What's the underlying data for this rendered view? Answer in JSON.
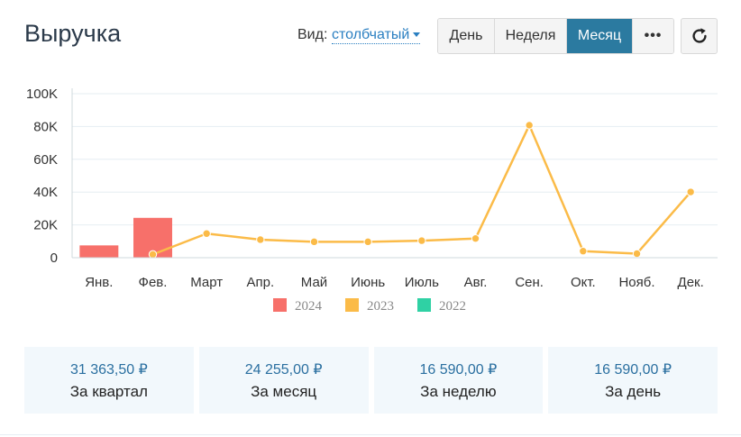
{
  "header": {
    "title": "Выручка",
    "view_label": "Вид:",
    "view_value": "столбчатый",
    "periods": [
      "День",
      "Неделя",
      "Месяц"
    ],
    "active_period": "Месяц",
    "more_label": "•••"
  },
  "icons": {
    "refresh": "refresh-icon",
    "more": "more-icon",
    "caret": "chevron-down-icon"
  },
  "colors": {
    "s2024": "#f7706a",
    "s2023": "#fbbb48",
    "s2022": "#2fd1a4",
    "accent": "#2b7aa0"
  },
  "chart_data": {
    "type": "bar",
    "categories": [
      "Янв.",
      "Фев.",
      "Март",
      "Апр.",
      "Май",
      "Июнь",
      "Июль",
      "Авг.",
      "Сен.",
      "Окт.",
      "Нояб.",
      "Дек."
    ],
    "ylim": [
      0,
      100000
    ],
    "yticks": [
      0,
      20000,
      40000,
      60000,
      80000,
      100000
    ],
    "ytick_labels": [
      "0",
      "20K",
      "40K",
      "60K",
      "80K",
      "100K"
    ],
    "grid": true,
    "legend": "bottom",
    "series": [
      {
        "name": "2024",
        "kind": "bar",
        "color": "#f7706a",
        "values": [
          7500,
          24300,
          null,
          null,
          null,
          null,
          null,
          null,
          null,
          null,
          null,
          null
        ]
      },
      {
        "name": "2023",
        "kind": "line",
        "color": "#fbbb48",
        "values": [
          null,
          2000,
          14700,
          11000,
          9700,
          9700,
          10400,
          11700,
          80800,
          4000,
          2500,
          40100
        ]
      },
      {
        "name": "2022",
        "kind": "line",
        "color": "#2fd1a4",
        "values": []
      }
    ]
  },
  "summary": [
    {
      "value": "31 363,50 ₽",
      "label": "За квартал"
    },
    {
      "value": "24 255,00 ₽",
      "label": "За месяц"
    },
    {
      "value": "16 590,00 ₽",
      "label": "За неделю"
    },
    {
      "value": "16 590,00 ₽",
      "label": "За день"
    }
  ]
}
